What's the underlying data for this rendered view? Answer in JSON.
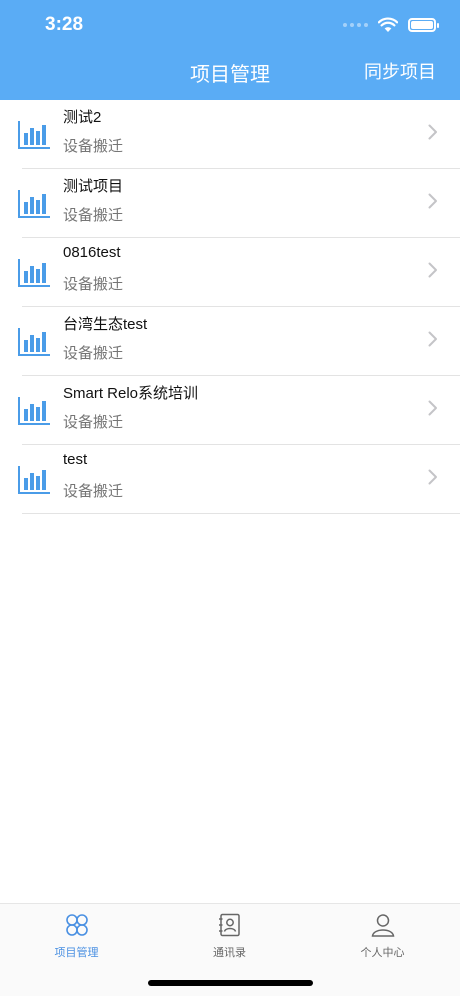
{
  "status_bar": {
    "time": "3:28"
  },
  "nav": {
    "title": "项目管理",
    "action_label": "同步项目"
  },
  "projects": [
    {
      "name": "测试2",
      "subtitle": "设备搬迁"
    },
    {
      "name": "测试项目",
      "subtitle": "设备搬迁"
    },
    {
      "name": "0816test",
      "subtitle": "设备搬迁"
    },
    {
      "name": "台湾生态test",
      "subtitle": "设备搬迁"
    },
    {
      "name": "Smart Relo系统培训",
      "subtitle": "设备搬迁"
    },
    {
      "name": "test",
      "subtitle": "设备搬迁"
    }
  ],
  "tabbar": {
    "tabs": [
      {
        "label": "项目管理",
        "icon": "clover-icon",
        "active": true
      },
      {
        "label": "通讯录",
        "icon": "contacts-book-icon",
        "active": false
      },
      {
        "label": "个人中心",
        "icon": "person-icon",
        "active": false
      }
    ]
  },
  "colors": {
    "header_bg": "#5aacf5",
    "icon_blue": "#4a9ce8",
    "tab_active": "#4a90e2",
    "tab_inactive": "#666666"
  }
}
